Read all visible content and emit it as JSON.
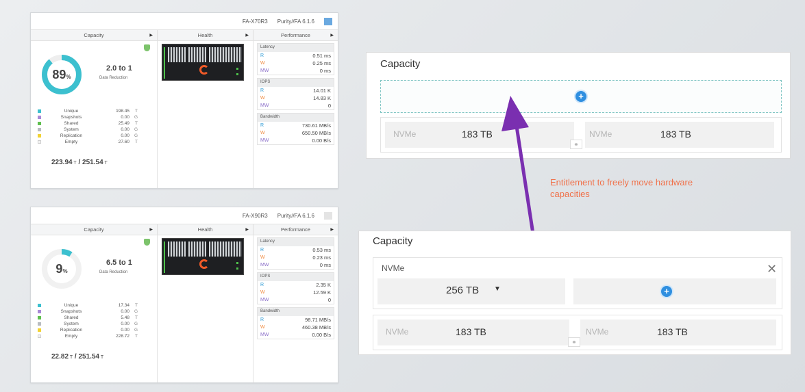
{
  "arrays": [
    {
      "model": "FA-X70R3",
      "os": "Purity//FA 6.1.6",
      "tabs": [
        "Capacity",
        "Health",
        "Performance"
      ],
      "capacity": {
        "percent": "89",
        "percent_unit": "%",
        "percent_value": 89,
        "reduction": "2.0 to 1",
        "reduction_label": "Data Reduction",
        "legend": [
          {
            "name": "Unique",
            "value": "198.45",
            "unit": "T",
            "color": "#3cc0cf"
          },
          {
            "name": "Snapshots",
            "value": "0.00",
            "unit": "G",
            "color": "#a98ad6"
          },
          {
            "name": "Shared",
            "value": "25.49",
            "unit": "T",
            "color": "#5fbf4f"
          },
          {
            "name": "System",
            "value": "0.00",
            "unit": "G",
            "color": "#b8bcc0"
          },
          {
            "name": "Replication",
            "value": "0.00",
            "unit": "G",
            "color": "#f2d233"
          },
          {
            "name": "Empty",
            "value": "27.60",
            "unit": "T",
            "color": "#f3f3f3"
          }
        ],
        "used": "223.94",
        "total": "251.54",
        "unit": "T"
      },
      "performance": {
        "latency_label": "Latency",
        "latency": [
          {
            "key": "R",
            "value": "0.51 ms"
          },
          {
            "key": "W",
            "value": "0.25 ms"
          },
          {
            "key": "MW",
            "value": "0 ms"
          }
        ],
        "iops_label": "IOPS",
        "iops": [
          {
            "key": "R",
            "value": "14.01 K"
          },
          {
            "key": "W",
            "value": "14.83 K"
          },
          {
            "key": "MW",
            "value": "0"
          }
        ],
        "bandwidth_label": "Bandwidth",
        "bandwidth": [
          {
            "key": "R",
            "value": "730.61 MB/s"
          },
          {
            "key": "W",
            "value": "650.50 MB/s"
          },
          {
            "key": "MW",
            "value": "0.00 B/s"
          }
        ]
      }
    },
    {
      "model": "FA-X90R3",
      "os": "Purity//FA 6.1.6",
      "tabs": [
        "Capacity",
        "Health",
        "Performance"
      ],
      "capacity": {
        "percent": "9",
        "percent_unit": "%",
        "percent_value": 9,
        "reduction": "6.5 to 1",
        "reduction_label": "Data Reduction",
        "legend": [
          {
            "name": "Unique",
            "value": "17.34",
            "unit": "T",
            "color": "#3cc0cf"
          },
          {
            "name": "Snapshots",
            "value": "0.00",
            "unit": "G",
            "color": "#a98ad6"
          },
          {
            "name": "Shared",
            "value": "5.48",
            "unit": "T",
            "color": "#5fbf4f"
          },
          {
            "name": "System",
            "value": "0.00",
            "unit": "G",
            "color": "#b8bcc0"
          },
          {
            "name": "Replication",
            "value": "0.00",
            "unit": "G",
            "color": "#f2d233"
          },
          {
            "name": "Empty",
            "value": "228.72",
            "unit": "T",
            "color": "#f3f3f3"
          }
        ],
        "used": "22.82",
        "total": "251.54",
        "unit": "T"
      },
      "performance": {
        "latency_label": "Latency",
        "latency": [
          {
            "key": "R",
            "value": "0.53 ms"
          },
          {
            "key": "W",
            "value": "0.23 ms"
          },
          {
            "key": "MW",
            "value": "0 ms"
          }
        ],
        "iops_label": "IOPS",
        "iops": [
          {
            "key": "R",
            "value": "2.35 K"
          },
          {
            "key": "W",
            "value": "12.59 K"
          },
          {
            "key": "MW",
            "value": "0"
          }
        ],
        "bandwidth_label": "Bandwidth",
        "bandwidth": [
          {
            "key": "R",
            "value": "98.71 MB/s"
          },
          {
            "key": "W",
            "value": "460.38 MB/s"
          },
          {
            "key": "MW",
            "value": "0.00 B/s"
          }
        ]
      }
    }
  ],
  "card_top": {
    "title": "Capacity",
    "slots": [
      {
        "type": "NVMe",
        "size": "183 TB"
      },
      {
        "type": "NVMe",
        "size": "183 TB"
      }
    ]
  },
  "annotation": {
    "line1": "Entitlement to freely move hardware",
    "line2": "capacities",
    "color": "#f0714a",
    "arrow_color": "#7a2fb0"
  },
  "card_bottom": {
    "title": "Capacity",
    "new_type": "NVMe",
    "selected_size": "256 TB",
    "slots": [
      {
        "type": "NVMe",
        "size": "183 TB"
      },
      {
        "type": "NVMe",
        "size": "183 TB"
      }
    ]
  }
}
